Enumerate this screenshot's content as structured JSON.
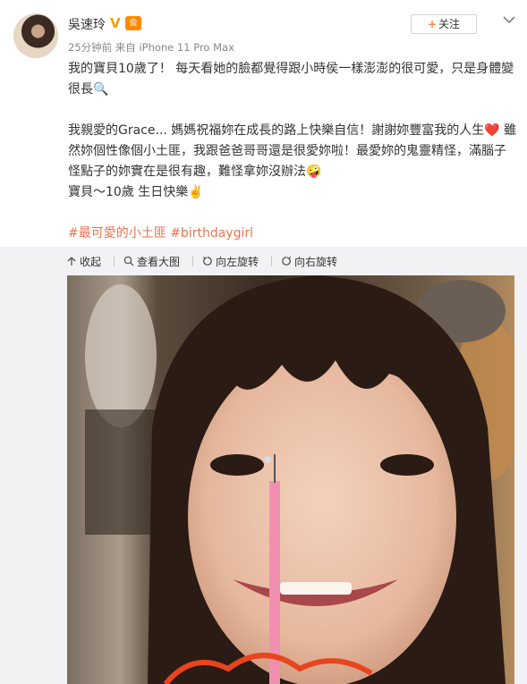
{
  "header": {
    "username": "吳速玲",
    "verified_badge": "V",
    "member_badge": "会",
    "meta": "25分钟前 来自 iPhone 11 Pro Max",
    "follow_label": "关注",
    "follow_plus": "+"
  },
  "post": {
    "line1": "我的寶貝10歲了！ 每天看她的臉都覺得跟小時侯一樣澎澎的很可愛，只是身體變",
    "line2": "很長",
    "line2_emoji": "🔍",
    "line3": "我親愛的Grace... 媽媽祝福妳在成長的路上快樂自信！謝謝妳豐富我的人生",
    "line3_emoji": "❤️",
    "line3_tail": " 雖",
    "line4": "然妳個性像個小土匪，我跟爸爸哥哥還是很愛妳啦！最愛妳的鬼靈精怪，滿腦子",
    "line5": "怪點子的妳實在是很有趣，難怪拿妳沒辦法",
    "line5_emoji": "🤪",
    "line6": "寶貝～10歲 生日快樂",
    "line6_emoji": "✌️",
    "hashtag1": "#最可愛的小土匪",
    "hashtag2": "#birthdaygirl"
  },
  "toolbar": {
    "collapse_label": "收起",
    "view_large_label": "查看大图",
    "rotate_left_label": "向左旋转",
    "rotate_right_label": "向右旋转"
  },
  "colors": {
    "accent_orange": "#ff8140",
    "hashtag": "#eb7350",
    "verified": "#f4a100"
  }
}
